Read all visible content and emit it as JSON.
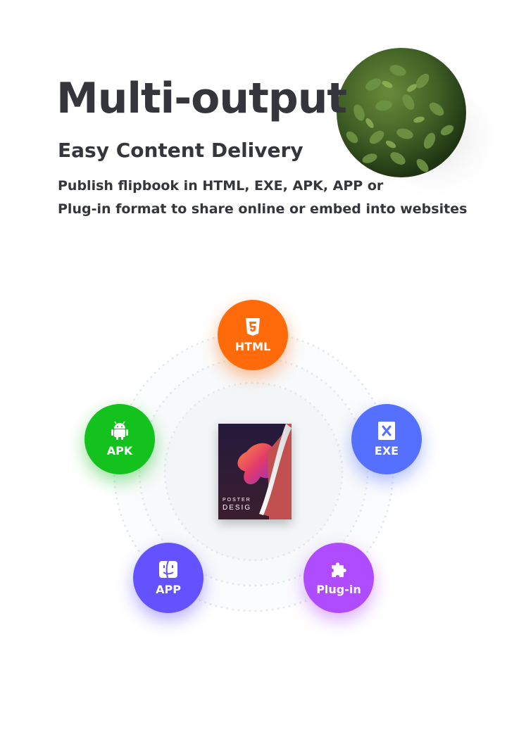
{
  "header": {
    "title": "Multi-output",
    "subtitle": "Easy Content Delivery",
    "description_lines": [
      "Publish flipbook in HTML, EXE, APK, APP or",
      "Plug-in format to share online or embed into websites"
    ]
  },
  "book": {
    "cover_line1": "POSTER",
    "cover_line2": "DESIG"
  },
  "outputs": [
    {
      "label": "HTML",
      "icon": "html5-icon",
      "color": "#ff6a0a"
    },
    {
      "label": "EXE",
      "icon": "exe-x-icon",
      "color": "#5570ff"
    },
    {
      "label": "APK",
      "icon": "android-icon",
      "color": "#14c21e"
    },
    {
      "label": "APP",
      "icon": "mac-finder-icon",
      "color": "#6452ff"
    },
    {
      "label": "Plug-in",
      "icon": "puzzle-icon",
      "color": "#b04cff"
    }
  ]
}
